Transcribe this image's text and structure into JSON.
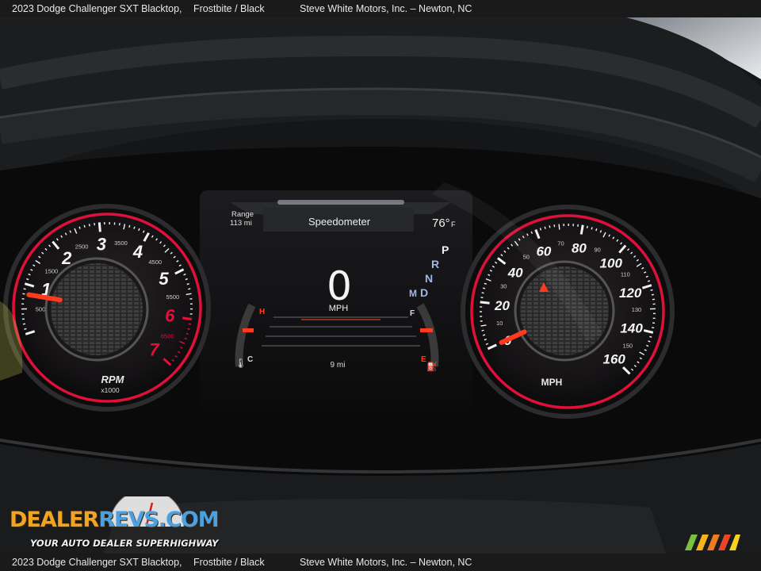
{
  "caption": {
    "vehicle": "2023 Dodge Challenger SXT Blacktop,",
    "color": "Frostbite / Black",
    "dealer": "Steve White Motors, Inc. – Newton, NC"
  },
  "cluster": {
    "center_title": "Speedometer",
    "range_label": "Range",
    "range_value": "113 mi",
    "temperature": "76°",
    "temperature_unit": "F",
    "digital_speed": "0",
    "digital_speed_unit": "MPH",
    "trip": "9 mi",
    "gear_letters": [
      "P",
      "R",
      "N",
      "D"
    ],
    "manual_mode": "M",
    "temp_gauge_hot": "H",
    "temp_gauge_cold": "C",
    "fuel_full": "F",
    "fuel_empty": "E",
    "tachometer": {
      "label": "RPM",
      "sublabel": "x1000",
      "major_ticks": [
        "1",
        "2",
        "3",
        "4",
        "5",
        "6",
        "7"
      ],
      "minor_ticks": [
        "500",
        "1500",
        "2500",
        "3500",
        "4500",
        "5500",
        "6500"
      ],
      "value_rpm": 800
    },
    "speedometer": {
      "label": "MPH",
      "major_ticks": [
        "0",
        "20",
        "40",
        "60",
        "80",
        "100",
        "120",
        "140",
        "160"
      ],
      "minor_ticks": [
        "10",
        "30",
        "50",
        "70",
        "90",
        "110",
        "130",
        "150"
      ],
      "value_mph": 0
    }
  },
  "watermark": {
    "logo_part1": "DEALER",
    "logo_part2": "REVS",
    "logo_part3": ".COM",
    "tagline": "YOUR AUTO DEALER SUPERHIGHWAY"
  },
  "colors": {
    "gauge_ring": "#e0103a",
    "needle": "#ff3a1e",
    "logo_orange": "#f3a322",
    "logo_blue": "#4aa0e0"
  }
}
